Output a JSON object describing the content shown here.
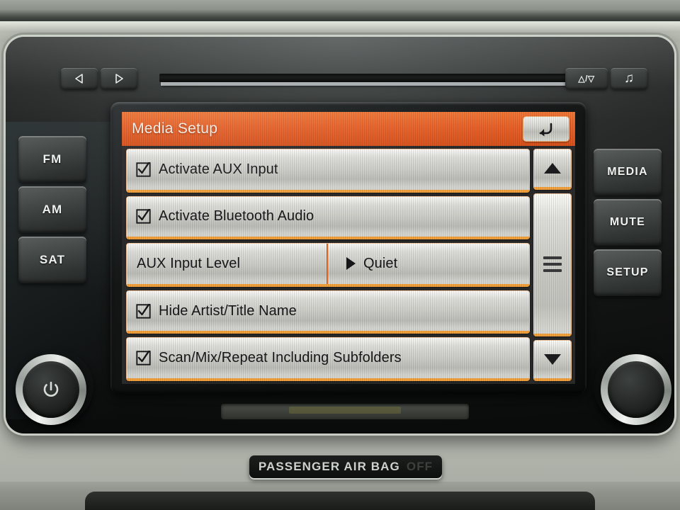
{
  "device": {
    "name": "car-infotainment-head-unit",
    "accent_orange": "#e8622a",
    "row_accent": "#f2a03c",
    "screen_bg": "#2b2b2b"
  },
  "transport_buttons": [
    {
      "name": "previous",
      "icon": "triangle-left-icon",
      "label": ""
    },
    {
      "name": "next",
      "icon": "triangle-right-icon",
      "label": ""
    }
  ],
  "top_right_buttons": [
    {
      "name": "eject",
      "icon": "eject-icon",
      "label": "△/▽"
    },
    {
      "name": "music-source",
      "icon": "music-note-icon",
      "label": "♫"
    }
  ],
  "left_buttons": [
    {
      "label": "FM"
    },
    {
      "label": "AM"
    },
    {
      "label": "SAT"
    }
  ],
  "right_buttons": [
    {
      "label": "MEDIA"
    },
    {
      "label": "MUTE"
    },
    {
      "label": "SETUP"
    }
  ],
  "screen": {
    "header": {
      "title": "Media Setup",
      "back_icon": "back-arrow-icon"
    },
    "menu_items": [
      {
        "type": "checkbox",
        "label": "Activate AUX Input",
        "checked": true
      },
      {
        "type": "checkbox",
        "label": "Activate Bluetooth Audio",
        "checked": true
      },
      {
        "type": "value",
        "label": "AUX Input Level",
        "value": "Quiet",
        "value_icon": "triangle-right-icon"
      },
      {
        "type": "checkbox",
        "label": "Hide Artist/Title Name",
        "checked": true
      },
      {
        "type": "checkbox",
        "label": "Scan/Mix/Repeat Including Subfolders",
        "checked": true
      }
    ],
    "scrollbar": {
      "up_icon": "triangle-up-icon",
      "thumb_icon": "grip-lines-icon",
      "down_icon": "triangle-down-icon"
    }
  },
  "knobs": [
    {
      "name": "power-volume",
      "icon": "power-icon"
    },
    {
      "name": "tune-scroll",
      "icon": "blank-knob-icon"
    }
  ],
  "airbag_indicator": {
    "text": "PASSENGER AIR BAG",
    "status": "OFF"
  }
}
